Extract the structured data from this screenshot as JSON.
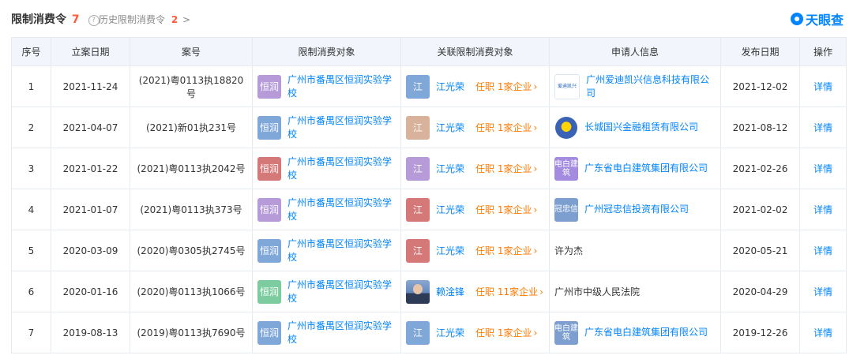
{
  "header": {
    "title": "限制消费令",
    "count": "7",
    "help_icon": "question-circle-icon",
    "history_label": "历史限制消费令",
    "history_count": "2",
    "history_chevron": ">",
    "brand": "天眼查"
  },
  "columns": [
    "序号",
    "立案日期",
    "案号",
    "限制消费对象",
    "关联限制消费对象",
    "申请人信息",
    "发布日期",
    "操作"
  ],
  "rows": [
    {
      "idx": "1",
      "filed": "2021-11-24",
      "case_no": "(2021)粤0113执18820号",
      "target_badge": "恒润",
      "target_color": "#b69bd8",
      "target": "广州市番禺区恒润实验学校",
      "rel_badge": "江",
      "rel_color": "#7fa8d8",
      "rel_name": "江光荣",
      "rel_role": "任职 1家企业",
      "applicant_logo": "edk-logo",
      "applicant_logo_text": "爱迪凯兴",
      "applicant": "广州爱迪凯兴信息科技有限公司",
      "applicant_link": true,
      "published": "2021-12-02",
      "action": "详情"
    },
    {
      "idx": "2",
      "filed": "2021-04-07",
      "case_no": "(2021)新01执231号",
      "target_badge": "恒润",
      "target_color": "#7fa8d8",
      "target": "广州市番禺区恒润实验学校",
      "rel_badge": "江",
      "rel_color": "#d8b29a",
      "rel_name": "江光荣",
      "rel_role": "任职 1家企业",
      "applicant_logo": "great-wall-logo",
      "applicant_logo_text": "",
      "applicant": "长城国兴金融租赁有限公司",
      "applicant_link": true,
      "published": "2021-08-12",
      "action": "详情"
    },
    {
      "idx": "3",
      "filed": "2021-01-22",
      "case_no": "(2021)粤0113执2042号",
      "target_badge": "恒润",
      "target_color": "#d57878",
      "target": "广州市番禺区恒润实验学校",
      "rel_badge": "江",
      "rel_color": "#b69bd8",
      "rel_name": "江光荣",
      "rel_role": "任职 1家企业",
      "applicant_logo": "badge",
      "applicant_logo_text": "电白建筑",
      "applicant_logo_color": "#a38be0",
      "applicant": "广东省电白建筑集团有限公司",
      "applicant_link": true,
      "published": "2021-02-26",
      "action": "详情"
    },
    {
      "idx": "4",
      "filed": "2021-01-07",
      "case_no": "(2021)粤0113执373号",
      "target_badge": "恒润",
      "target_color": "#b69bd8",
      "target": "广州市番禺区恒润实验学校",
      "rel_badge": "江",
      "rel_color": "#d57878",
      "rel_name": "江光荣",
      "rel_role": "任职 1家企业",
      "applicant_logo": "badge",
      "applicant_logo_text": "冠忠信",
      "applicant_logo_color": "#7c9fd0",
      "applicant": "广州冠忠信投资有限公司",
      "applicant_link": true,
      "published": "2021-02-02",
      "action": "详情"
    },
    {
      "idx": "5",
      "filed": "2020-03-09",
      "case_no": "(2020)粤0305执2745号",
      "target_badge": "恒润",
      "target_color": "#7fa8d8",
      "target": "广州市番禺区恒润实验学校",
      "rel_badge": "江",
      "rel_color": "#d57878",
      "rel_name": "江光荣",
      "rel_role": "任职 1家企业",
      "applicant_logo": "",
      "applicant_logo_text": "",
      "applicant": "许为杰",
      "applicant_link": false,
      "published": "2020-05-21",
      "action": "详情"
    },
    {
      "idx": "6",
      "filed": "2020-01-16",
      "case_no": "(2020)粤0113执1066号",
      "target_badge": "恒润",
      "target_color": "#7dcca0",
      "target": "广州市番禺区恒润实验学校",
      "rel_badge": "photo",
      "rel_color": "",
      "rel_name": "赖淦锋",
      "rel_role": "任职 11家企业",
      "applicant_logo": "",
      "applicant_logo_text": "",
      "applicant": "广州市中级人民法院",
      "applicant_link": false,
      "published": "2020-04-29",
      "action": "详情"
    },
    {
      "idx": "7",
      "filed": "2019-08-13",
      "case_no": "(2019)粤0113执7690号",
      "target_badge": "恒润",
      "target_color": "#7fa8d8",
      "target": "广州市番禺区恒润实验学校",
      "rel_badge": "江",
      "rel_color": "#7fa8d8",
      "rel_name": "江光荣",
      "rel_role": "任职 1家企业",
      "applicant_logo": "badge",
      "applicant_logo_text": "电白建筑",
      "applicant_logo_color": "#7c9fd0",
      "applicant": "广东省电白建筑集团有限公司",
      "applicant_link": true,
      "published": "2019-12-26",
      "action": "详情"
    }
  ],
  "colors": {
    "link": "#0084ff",
    "accent": "#ff5b3a",
    "role": "#ff7a00",
    "header_bg": "#f2f6fc"
  }
}
